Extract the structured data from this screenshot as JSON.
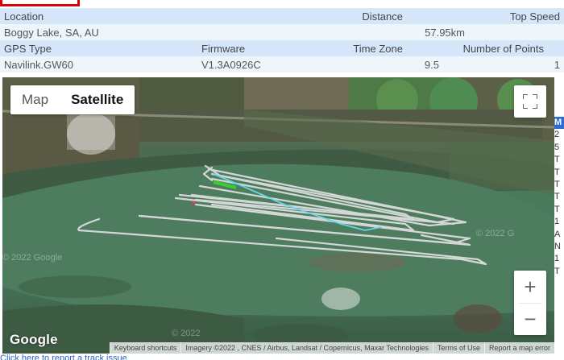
{
  "summary": {
    "headers_row1": {
      "location": "Location",
      "distance": "Distance",
      "top_speed": "Top Speed"
    },
    "values_row1": {
      "location": "Boggy Lake, SA, AU",
      "distance": "57.95km"
    },
    "headers_row2": {
      "gps_type": "GPS Type",
      "firmware": "Firmware",
      "time_zone": "Time Zone",
      "points": "Number of Points"
    },
    "values_row2": {
      "gps_type": "Navilink.GW60",
      "firmware": "V1.3A0926C",
      "time_zone": "9.5",
      "points_partial": "1"
    }
  },
  "map": {
    "type_map": "Map",
    "type_satellite": "Satellite",
    "selected_type": "Satellite",
    "zoom_in": "+",
    "zoom_out": "−",
    "logo": "Google",
    "watermark_right": "© 2022 G",
    "watermark_left": "© 2022 Google",
    "watermark_bottom": "© 2022",
    "attribution": {
      "shortcuts": "Keyboard shortcuts",
      "imagery": "Imagery ©2022 , CNES / Airbus, Landsat / Copernicus, Maxar Technologies",
      "terms": "Terms of Use",
      "report": "Report a map error"
    },
    "icons": {
      "fullscreen": "fullscreen-icon"
    },
    "colors": {
      "track": "#e0e0e0",
      "track_cyan": "#63d6e8",
      "track_green": "#37d02e",
      "water": "#4a7a5c"
    }
  },
  "side_panel_cut": [
    "M",
    "2",
    "5",
    "T",
    "T",
    "T",
    "T",
    "T",
    "1",
    "A",
    "N",
    "1",
    "T"
  ],
  "footer": {
    "report_link": "Click here to report a track issue"
  }
}
